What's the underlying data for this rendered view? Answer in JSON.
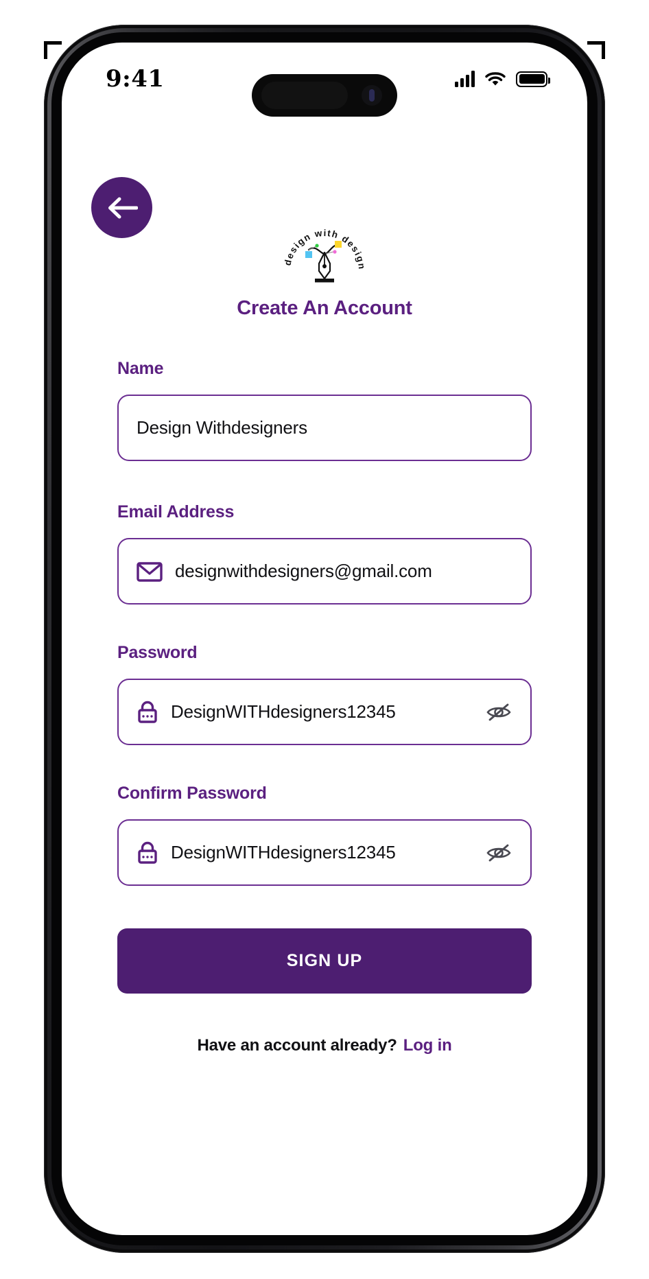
{
  "statusbar": {
    "time": "9:41",
    "signal_icon": "cellular-signal-icon",
    "wifi_icon": "wifi-icon",
    "battery_icon": "battery-icon"
  },
  "nav": {
    "back_icon": "arrow-left-icon"
  },
  "brand": {
    "logo_icon": "design-with-designers-logo",
    "logo_text": "design with designers",
    "accent_color": "#4D1E71",
    "label_color": "#5B2080",
    "border_color": "#6B2E92"
  },
  "page": {
    "title": "Create An Account"
  },
  "form": {
    "fields": [
      {
        "label": "Name",
        "value": "Design Withdesigners",
        "placeholder": "Name",
        "icon": null,
        "toggle": null
      },
      {
        "label": "Email Address",
        "value": "designwithdesigners@gmail.com",
        "placeholder": "Email Address",
        "icon": "envelope-icon",
        "toggle": null
      },
      {
        "label": "Password",
        "value": "DesignWITHdesigners12345",
        "placeholder": "Password",
        "icon": "lock-icon",
        "toggle": "eye-off-icon"
      },
      {
        "label": "Confirm Password",
        "value": "DesignWITHdesigners12345",
        "placeholder": "Confirm Password",
        "icon": "lock-icon",
        "toggle": "eye-off-icon"
      }
    ],
    "submit_label": "SIGN UP"
  },
  "footer": {
    "prompt": "Have an account already?",
    "login_label": "Log in"
  }
}
